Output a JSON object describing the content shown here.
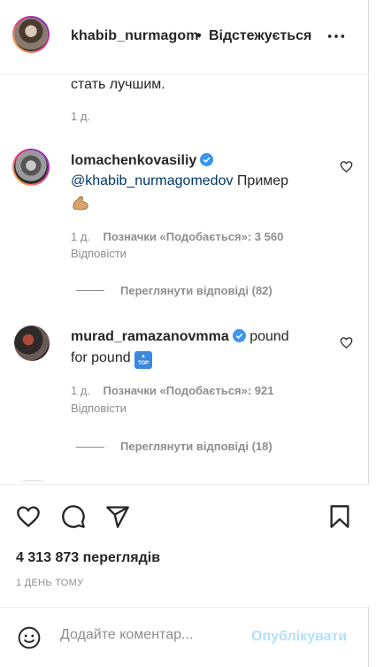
{
  "header": {
    "username": "khabib_nurmagomedov",
    "separator": "•",
    "follow_label": "Відстежується"
  },
  "comments": [
    {
      "text": "стать лучшим.",
      "time": "1 д."
    },
    {
      "username": "lomachenkovasiliy",
      "mention": "@khabib_nurmagomedov",
      "text": "Пример",
      "emoji": "flexed-biceps",
      "time": "1 д.",
      "likes_label": "Позначки «Подобається»: 3 560",
      "reply_label": "Відповісти",
      "view_replies": "Переглянути відповіді (82)"
    },
    {
      "username": "murad_ramazanovmma",
      "text_line1": "pound",
      "text_line2": "for pound",
      "emoji": "top-arrow",
      "emoji_text": "TOP",
      "time": "1 д.",
      "likes_label": "Позначки «Подобається»: 921",
      "reply_label": "Відповісти",
      "view_replies": "Переглянути відповіді (18)"
    }
  ],
  "post": {
    "views": "4 313 873 переглядів",
    "date": "1 ДЕНЬ ТОМУ"
  },
  "comment_input": {
    "placeholder": "Додайте коментар...",
    "post_label": "Опублікувати"
  },
  "colors": {
    "verified": "#3897f0",
    "mention": "#00376b",
    "post_disabled": "#b2dffc",
    "muted": "#8e8e8e"
  }
}
